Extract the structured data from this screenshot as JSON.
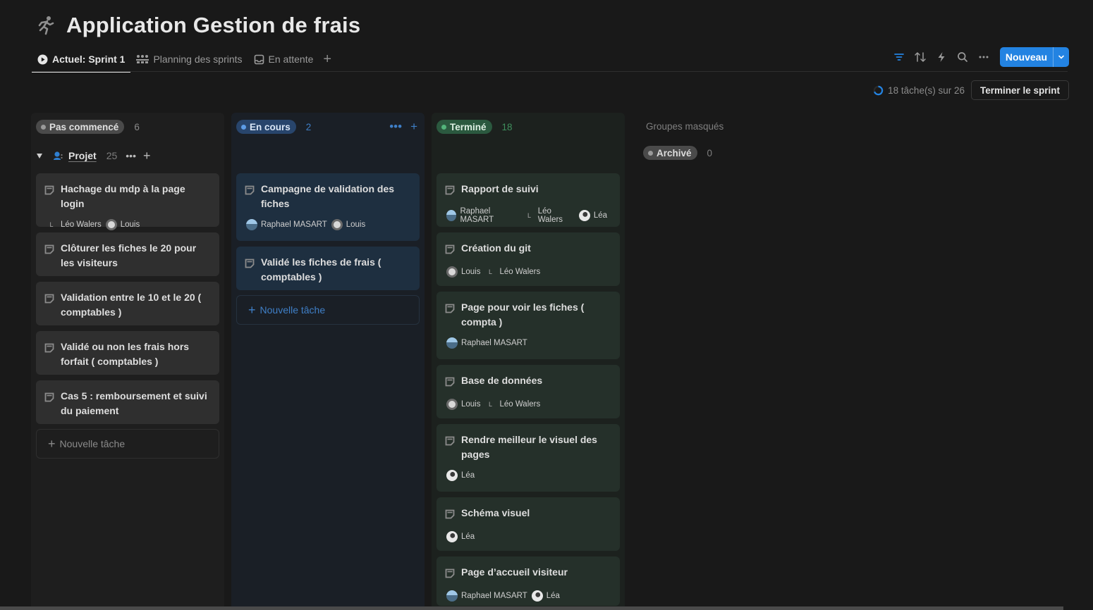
{
  "page": {
    "title": "Application Gestion de frais",
    "icon": "running-person-icon"
  },
  "tabs": [
    {
      "label": "Actuel: Sprint 1",
      "icon": "play-circle-icon",
      "active": true
    },
    {
      "label": "Planning des sprints",
      "icon": "sprint-planning-icon",
      "active": false
    },
    {
      "label": "En attente",
      "icon": "inbox-tray-icon",
      "active": false
    }
  ],
  "toolbar": {
    "icons": [
      "filter-icon",
      "sort-icon",
      "lightning-icon",
      "search-icon",
      "more-icon"
    ],
    "new_label": "Nouveau"
  },
  "sprint": {
    "progress_text": "18 tâche(s) sur 26",
    "finish_label": "Terminer le sprint"
  },
  "colors": {
    "accent": "#2383e2",
    "not_started": "#5a5a5a",
    "in_progress": "#28456c",
    "done": "#2b593f"
  },
  "columns": [
    {
      "status": "Pas commencé",
      "count": "6",
      "cards": [
        {
          "title": "Hachage du mdp à la page login",
          "assignees": [
            "Léo Walers",
            "Louis"
          ]
        },
        {
          "title": "Clôturer les fiches le 20 pour les visiteurs",
          "assignees": []
        },
        {
          "title": "Validation entre le 10 et le 20 ( comptables )",
          "assignees": []
        },
        {
          "title": "Validé ou non les frais hors forfait ( comptables )",
          "assignees": []
        },
        {
          "title": "Cas 5 : remboursement et suivi du paiement",
          "assignees": []
        }
      ],
      "new_task": "Nouvelle tâche"
    },
    {
      "status": "En cours",
      "count": "2",
      "cards": [
        {
          "title": "Campagne de validation des fiches",
          "assignees": [
            "Raphael MASART",
            "Louis"
          ]
        },
        {
          "title": "Validé les fiches de frais ( comptables )",
          "assignees": []
        }
      ],
      "new_task": "Nouvelle tâche"
    },
    {
      "status": "Terminé",
      "count": "18",
      "cards": [
        {
          "title": "Rapport de suivi",
          "assignees": [
            "Raphael MASART",
            "Léo Walers",
            "Léa"
          ]
        },
        {
          "title": "Création du git",
          "assignees": [
            "Louis",
            "Léo Walers"
          ]
        },
        {
          "title": "Page pour voir les fiches ( compta )",
          "assignees": [
            "Raphael MASART"
          ]
        },
        {
          "title": "Base de données",
          "assignees": [
            "Louis",
            "Léo Walers"
          ]
        },
        {
          "title": "Rendre meilleur le visuel des pages",
          "assignees": [
            "Léa"
          ]
        },
        {
          "title": "Schéma visuel",
          "assignees": [
            "Léa"
          ]
        },
        {
          "title": "Page d’accueil visiteur",
          "assignees": [
            "Raphael MASART",
            "Léa"
          ]
        }
      ]
    }
  ],
  "group": {
    "name": "Projet",
    "count": "25",
    "icon": "people-icon"
  },
  "hidden_groups": {
    "label": "Groupes masqués",
    "items": [
      {
        "status": "Archivé",
        "count": "0"
      }
    ]
  },
  "avatar_letters": {
    "leo": "L"
  }
}
